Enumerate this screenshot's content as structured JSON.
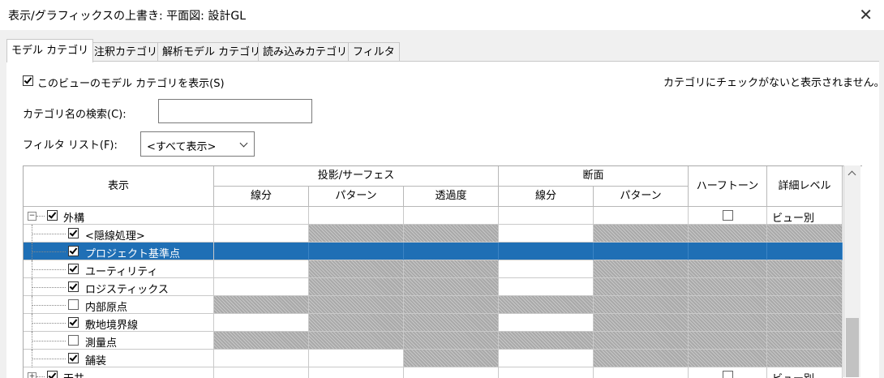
{
  "window": {
    "title": "表示/グラフィックスの上書き: 平面図: 設計GL",
    "close_glyph": "✕"
  },
  "tabs": [
    {
      "label": "モデル カテゴリ",
      "active": true
    },
    {
      "label": "注釈カテゴリ",
      "active": false
    },
    {
      "label": "解析モデル カテゴリ",
      "active": false
    },
    {
      "label": "読み込みカテゴリ",
      "active": false
    },
    {
      "label": "フィルタ",
      "active": false
    }
  ],
  "options": {
    "show_model_categories_label": "このビューのモデル カテゴリを表示(S)",
    "show_model_categories_checked": true,
    "note": "カテゴリにチェックがないと表示されません。",
    "search_label": "カテゴリ名の検索(C):",
    "search_value": "",
    "filter_label": "フィルタ リスト(F):",
    "filter_value": "<すべて表示>"
  },
  "grid": {
    "headers": {
      "display": "表示",
      "projection": "投影/サーフェス",
      "cut": "断面",
      "halftone": "ハーフトーン",
      "detail": "詳細レベル",
      "lines": "線分",
      "patterns": "パターン",
      "transparency": "透過度",
      "cut_lines": "線分",
      "cut_patterns": "パターン"
    },
    "rows": [
      {
        "name": "外構",
        "level": 0,
        "checked": true,
        "expander": "−",
        "selected": false,
        "na": [
          false,
          false,
          false,
          false,
          false
        ],
        "halftone": true,
        "halftone_checked": false,
        "detail": "ビュー別"
      },
      {
        "name": "<隠線処理>",
        "level": 1,
        "checked": true,
        "selected": false,
        "na": [
          false,
          true,
          true,
          false,
          true
        ],
        "halftone": false,
        "detail": ""
      },
      {
        "name": "プロジェクト基準点",
        "level": 1,
        "checked": true,
        "selected": true,
        "na": [
          true,
          true,
          true,
          true,
          true
        ],
        "halftone": false,
        "detail": ""
      },
      {
        "name": "ユーティリティ",
        "level": 1,
        "checked": true,
        "selected": false,
        "na": [
          false,
          true,
          true,
          false,
          true
        ],
        "halftone": false,
        "detail": ""
      },
      {
        "name": "ロジスティックス",
        "level": 1,
        "checked": true,
        "selected": false,
        "na": [
          false,
          true,
          true,
          false,
          true
        ],
        "halftone": false,
        "detail": ""
      },
      {
        "name": "内部原点",
        "level": 1,
        "checked": false,
        "selected": false,
        "na": [
          true,
          true,
          true,
          true,
          true
        ],
        "halftone": false,
        "detail": ""
      },
      {
        "name": "敷地境界線",
        "level": 1,
        "checked": true,
        "selected": false,
        "na": [
          false,
          true,
          true,
          false,
          true
        ],
        "halftone": false,
        "detail": ""
      },
      {
        "name": "測量点",
        "level": 1,
        "checked": false,
        "selected": false,
        "na": [
          true,
          true,
          true,
          true,
          true
        ],
        "halftone": false,
        "detail": ""
      },
      {
        "name": "舗装",
        "level": 1,
        "checked": true,
        "selected": false,
        "na": [
          false,
          false,
          true,
          false,
          true
        ],
        "halftone": false,
        "detail": ""
      },
      {
        "name": "天井",
        "level": 0,
        "checked": true,
        "expander": "+",
        "selected": false,
        "na": [
          false,
          false,
          false,
          false,
          false
        ],
        "halftone": true,
        "halftone_checked": false,
        "detail": "ビュー別"
      }
    ]
  }
}
